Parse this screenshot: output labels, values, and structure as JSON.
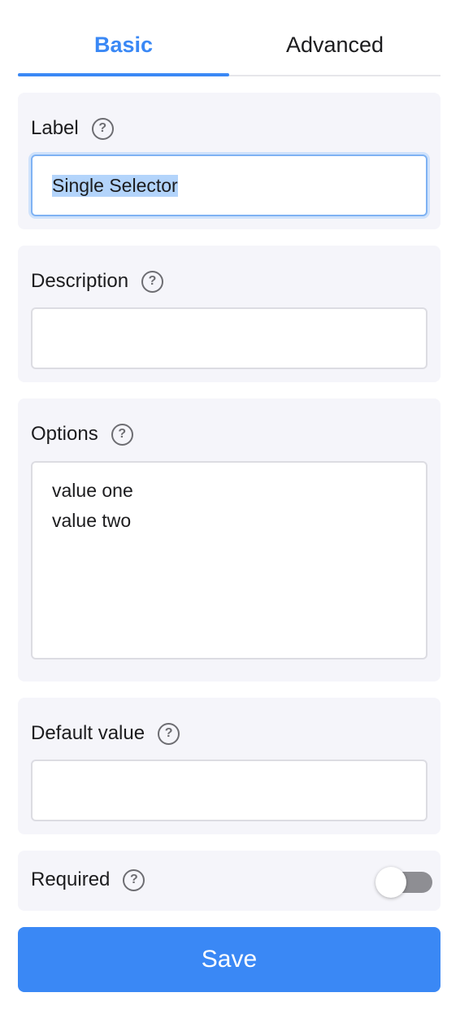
{
  "tabs": [
    {
      "label": "Basic",
      "active": true
    },
    {
      "label": "Advanced",
      "active": false
    }
  ],
  "fields": {
    "label": {
      "title": "Label",
      "value": "Single Selector"
    },
    "description": {
      "title": "Description",
      "value": ""
    },
    "options": {
      "title": "Options",
      "lines": [
        "value one",
        "value two"
      ]
    },
    "default_value": {
      "title": "Default value",
      "value": ""
    },
    "required": {
      "title": "Required",
      "on": false
    }
  },
  "help_glyph": "?",
  "save_label": "Save",
  "colors": {
    "accent": "#3a88f5",
    "card_bg": "#f5f5fa",
    "toggle_off": "#8e8e93"
  }
}
